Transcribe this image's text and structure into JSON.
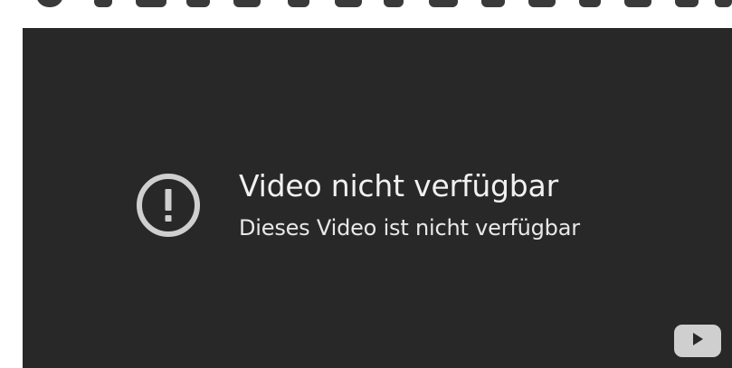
{
  "embed": {
    "error": {
      "icon": "exclamation-circle-icon",
      "title": "Video nicht verfügbar",
      "subtitle": "Dieses Video ist nicht verfügbar"
    },
    "logo": {
      "icon": "youtube-play-icon"
    }
  },
  "colors": {
    "background": "#282828",
    "text": "#f1f1f1",
    "icon": "#cfcfcf"
  }
}
